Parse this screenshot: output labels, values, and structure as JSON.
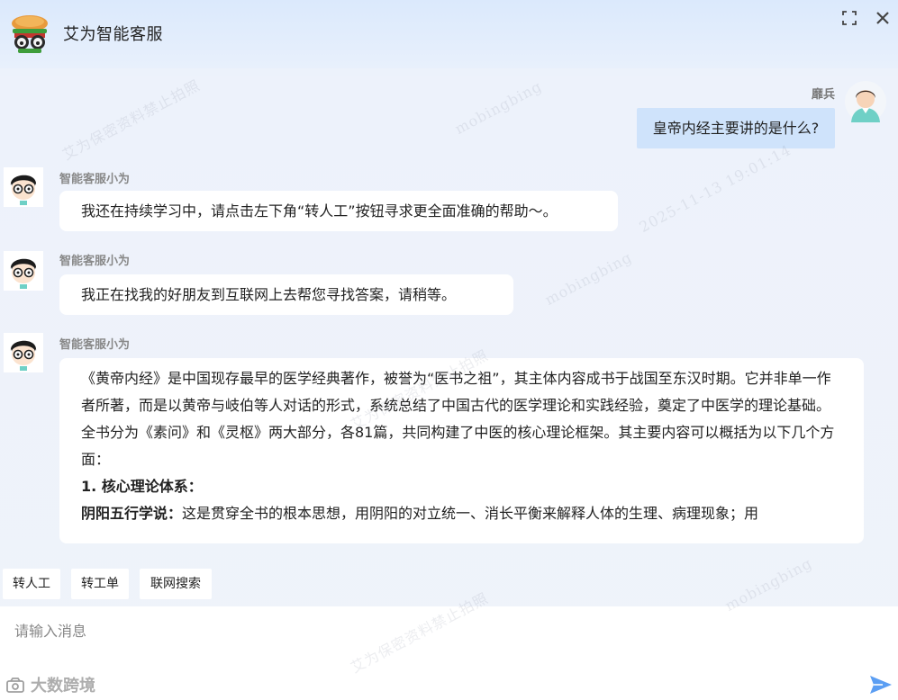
{
  "header": {
    "title": "艾为智能客服",
    "fullscreen_icon": "fullscreen-icon",
    "close_icon": "close-icon"
  },
  "chat": {
    "user": {
      "name": "靡兵",
      "message": "皇帝内经主要讲的是什么?"
    },
    "bot_name": "智能客服小为",
    "bot_messages": [
      "我还在持续学习中，请点击左下角“转人工”按钮寻求更全面准确的帮助～。",
      "我正在找我的好朋友到互联网上去帮您寻找答案，请稍等。"
    ],
    "answer": {
      "p1": "《黄帝内经》是中国现存最早的医学经典著作，被誉为“医书之祖”，其主体内容成书于战国至东汉时期。它并非单一作者所著，而是以黄帝与岐伯等人对话的形式，系统总结了中国古代的医学理论和实践经验，奠定了中医学的理论基础。",
      "p2": "全书分为《素问》和《灵枢》两大部分，各81篇，共同构建了中医的核心理论框架。其主要内容可以概括为以下几个方面：",
      "h1": "1. 核心理论体系：",
      "p3_bold": "阴阳五行学说：",
      "p3": "这是贯穿全书的根本思想，用阴阳的对立统一、消长平衡来解释人体的生理、病理现象；用"
    }
  },
  "quick_actions": [
    "转人工",
    "转工单",
    "联网搜索"
  ],
  "input": {
    "placeholder": "请输入消息"
  },
  "watermark": {
    "texts": [
      "艾为保密资料禁止拍照",
      "mobingbing",
      "2025-11-13 19:01:14"
    ],
    "logo_text": "大数跨境"
  },
  "colors": {
    "user_bubble": "#cfe3fb",
    "bot_bubble": "#ffffff",
    "header_bg": "#dbe9fc",
    "send_icon": "#5b9ef3"
  }
}
